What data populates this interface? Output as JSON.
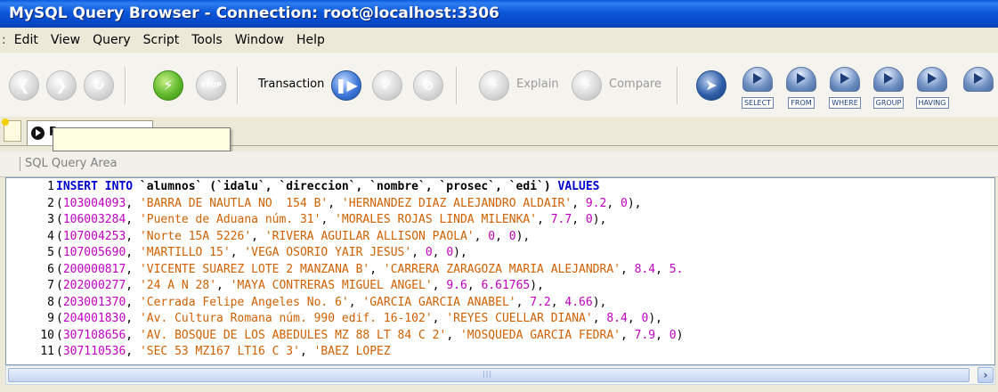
{
  "window": {
    "title": "MySQL Query Browser - Connection: root@localhost:3306"
  },
  "menu": [
    "Edit",
    "View",
    "Query",
    "Script",
    "Tools",
    "Window",
    "Help"
  ],
  "toolbar": {
    "transaction_label": "Transaction",
    "explain_label": "Explain",
    "compare_label": "Compare",
    "clauses": [
      "SELECT",
      "FROM",
      "WHERE",
      "GROUP",
      "HAVING"
    ]
  },
  "tab": {
    "label": "R"
  },
  "query_area_label": "SQL Query Area",
  "editor": {
    "lines": [
      {
        "n": "1",
        "parts": [
          [
            "kw",
            "INSERT INTO "
          ],
          [
            "id",
            "`alumnos` (`idalu`, `direccion`, `nombre`, `prosec`, `edi`) "
          ],
          [
            "kw",
            "VALUES"
          ]
        ]
      },
      {
        "n": "2",
        "parts": [
          [
            "pun",
            "("
          ],
          [
            "num",
            "103004093"
          ],
          [
            "pun",
            ", "
          ],
          [
            "str",
            "'BARRA DE NAUTLA NO  154 B'"
          ],
          [
            "pun",
            ", "
          ],
          [
            "str",
            "'HERNANDEZ DIAZ ALEJANDRO ALDAIR'"
          ],
          [
            "pun",
            ", "
          ],
          [
            "num",
            "9.2"
          ],
          [
            "pun",
            ", "
          ],
          [
            "num",
            "0"
          ],
          [
            "pun",
            "),"
          ]
        ]
      },
      {
        "n": "3",
        "parts": [
          [
            "pun",
            "("
          ],
          [
            "num",
            "106003284"
          ],
          [
            "pun",
            ", "
          ],
          [
            "str",
            "'Puente de Aduana núm. 31'"
          ],
          [
            "pun",
            ", "
          ],
          [
            "str",
            "'MORALES ROJAS LINDA MILENKA'"
          ],
          [
            "pun",
            ", "
          ],
          [
            "num",
            "7.7"
          ],
          [
            "pun",
            ", "
          ],
          [
            "num",
            "0"
          ],
          [
            "pun",
            "),"
          ]
        ]
      },
      {
        "n": "4",
        "parts": [
          [
            "pun",
            "("
          ],
          [
            "num",
            "107004253"
          ],
          [
            "pun",
            ", "
          ],
          [
            "str",
            "'Norte 15A 5226'"
          ],
          [
            "pun",
            ", "
          ],
          [
            "str",
            "'RIVERA AGUILAR ALLISON PAOLA'"
          ],
          [
            "pun",
            ", "
          ],
          [
            "num",
            "0"
          ],
          [
            "pun",
            ", "
          ],
          [
            "num",
            "0"
          ],
          [
            "pun",
            "),"
          ]
        ]
      },
      {
        "n": "5",
        "parts": [
          [
            "pun",
            "("
          ],
          [
            "num",
            "107005690"
          ],
          [
            "pun",
            ", "
          ],
          [
            "str",
            "'MARTILLO 15'"
          ],
          [
            "pun",
            ", "
          ],
          [
            "str",
            "'VEGA OSORIO YAIR JESUS'"
          ],
          [
            "pun",
            ", "
          ],
          [
            "num",
            "0"
          ],
          [
            "pun",
            ", "
          ],
          [
            "num",
            "0"
          ],
          [
            "pun",
            "),"
          ]
        ]
      },
      {
        "n": "6",
        "parts": [
          [
            "pun",
            "("
          ],
          [
            "num",
            "200000817"
          ],
          [
            "pun",
            ", "
          ],
          [
            "str",
            "'VICENTE SUAREZ LOTE 2 MANZANA B'"
          ],
          [
            "pun",
            ", "
          ],
          [
            "str",
            "'CARRERA ZARAGOZA MARIA ALEJANDRA'"
          ],
          [
            "pun",
            ", "
          ],
          [
            "num",
            "8.4"
          ],
          [
            "pun",
            ", "
          ],
          [
            "num",
            "5."
          ]
        ]
      },
      {
        "n": "7",
        "parts": [
          [
            "pun",
            "("
          ],
          [
            "num",
            "202000277"
          ],
          [
            "pun",
            ", "
          ],
          [
            "str",
            "'24 A N 28'"
          ],
          [
            "pun",
            ", "
          ],
          [
            "str",
            "'MAYA CONTRERAS MIGUEL ANGEL'"
          ],
          [
            "pun",
            ", "
          ],
          [
            "num",
            "9.6"
          ],
          [
            "pun",
            ", "
          ],
          [
            "num",
            "6.61765"
          ],
          [
            "pun",
            "),"
          ]
        ]
      },
      {
        "n": "8",
        "parts": [
          [
            "pun",
            "("
          ],
          [
            "num",
            "203001370"
          ],
          [
            "pun",
            ", "
          ],
          [
            "str",
            "'Cerrada Felipe Angeles No. 6'"
          ],
          [
            "pun",
            ", "
          ],
          [
            "str",
            "'GARCIA GARCIA ANABEL'"
          ],
          [
            "pun",
            ", "
          ],
          [
            "num",
            "7.2"
          ],
          [
            "pun",
            ", "
          ],
          [
            "num",
            "4.66"
          ],
          [
            "pun",
            "),"
          ]
        ]
      },
      {
        "n": "9",
        "parts": [
          [
            "pun",
            "("
          ],
          [
            "num",
            "204001830"
          ],
          [
            "pun",
            ", "
          ],
          [
            "str",
            "'Av. Cultura Romana núm. 990 edif. 16-102'"
          ],
          [
            "pun",
            ", "
          ],
          [
            "str",
            "'REYES CUELLAR DIANA'"
          ],
          [
            "pun",
            ", "
          ],
          [
            "num",
            "8.4"
          ],
          [
            "pun",
            ", "
          ],
          [
            "num",
            "0"
          ],
          [
            "pun",
            "),"
          ]
        ]
      },
      {
        "n": "10",
        "parts": [
          [
            "pun",
            "("
          ],
          [
            "num",
            "307108656"
          ],
          [
            "pun",
            ", "
          ],
          [
            "str",
            "'AV. BOSQUE DE LOS ABEDULES MZ 88 LT 84 C 2'"
          ],
          [
            "pun",
            ", "
          ],
          [
            "str",
            "'MOSQUEDA GARCIA FEDRA'"
          ],
          [
            "pun",
            ", "
          ],
          [
            "num",
            "7.9"
          ],
          [
            "pun",
            ", "
          ],
          [
            "num",
            "0"
          ],
          [
            "pun",
            ")"
          ]
        ]
      },
      {
        "n": "11",
        "parts": [
          [
            "pun",
            "("
          ],
          [
            "num",
            "307110536"
          ],
          [
            "pun",
            ", "
          ],
          [
            "str",
            "'SEC 53 MZ167 LT16 C 3'"
          ],
          [
            "pun",
            ", "
          ],
          [
            "str",
            "'BAEZ LOPEZ"
          ]
        ]
      }
    ]
  },
  "colors": {
    "title_bar": "#0a5ae0",
    "keyword": "#0000cc",
    "number": "#c000c0",
    "string": "#d06000"
  }
}
